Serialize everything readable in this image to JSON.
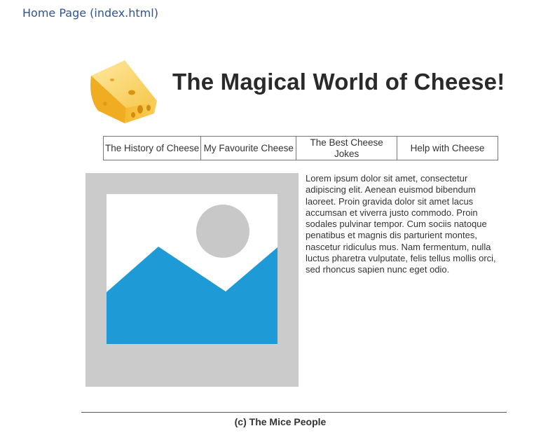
{
  "document": {
    "caption": "Home Page (index.html)"
  },
  "site": {
    "logo_icon": "cheese-wedge-icon",
    "title": "The Magical World of Cheese!",
    "nav": [
      {
        "label": "The History of Cheese"
      },
      {
        "label": "My Favourite Cheese"
      },
      {
        "label": "The Best Cheese Jokes"
      },
      {
        "label": "Help with Cheese"
      }
    ],
    "image_placeholder_icon": "image-placeholder-icon",
    "body_text": "Lorem ipsum dolor sit amet, consectetur adipiscing elit. Aenean euismod bibendum laoreet. Proin gravida dolor sit amet lacus accumsan et viverra justo commodo. Proin sodales pulvinar tempor. Cum sociis natoque penatibus et magnis dis parturient montes, nascetur ridiculus mus. Nam fermentum, nulla luctus pharetra vulputate, felis tellus mollis orci, sed rhoncus sapien nunc eget odio.",
    "footer": "(c) The Mice People"
  },
  "colors": {
    "caption": "#2f5496",
    "placeholder_bg": "#cbcbcb",
    "placeholder_mountain": "#1e9ad6",
    "placeholder_sun": "#c8c8c8",
    "cheese": "#f7c948"
  }
}
